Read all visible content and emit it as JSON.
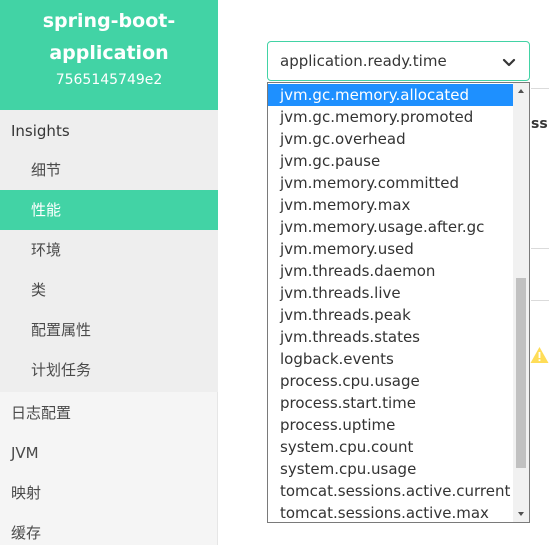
{
  "sidebar": {
    "app_name_line1": "spring-boot-",
    "app_name_line2": "application",
    "instance_id": "7565145749e2",
    "insights_label": "Insights",
    "insights_items": [
      {
        "label": "细节"
      },
      {
        "label": "性能"
      },
      {
        "label": "环境"
      },
      {
        "label": "类"
      },
      {
        "label": "配置属性"
      },
      {
        "label": "计划任务"
      }
    ],
    "active_item": "性能",
    "top_items": [
      {
        "label": "日志配置"
      },
      {
        "label": "JVM"
      },
      {
        "label": "映射"
      },
      {
        "label": "缓存"
      }
    ]
  },
  "main": {
    "metric_select": {
      "value": "application.ready.time"
    },
    "partial_text": "ss",
    "warning_icon": "warning-icon"
  },
  "dropdown": {
    "selected": "jvm.gc.memory.allocated",
    "options": [
      "jvm.gc.memory.allocated",
      "jvm.gc.memory.promoted",
      "jvm.gc.overhead",
      "jvm.gc.pause",
      "jvm.memory.committed",
      "jvm.memory.max",
      "jvm.memory.usage.after.gc",
      "jvm.memory.used",
      "jvm.threads.daemon",
      "jvm.threads.live",
      "jvm.threads.peak",
      "jvm.threads.states",
      "logback.events",
      "process.cpu.usage",
      "process.start.time",
      "process.uptime",
      "system.cpu.count",
      "system.cpu.usage",
      "tomcat.sessions.active.current",
      "tomcat.sessions.active.max"
    ]
  },
  "colors": {
    "brand_green": "#42d3a5",
    "selection_blue": "#1e90ff",
    "warning_yellow": "#ffdd57"
  }
}
